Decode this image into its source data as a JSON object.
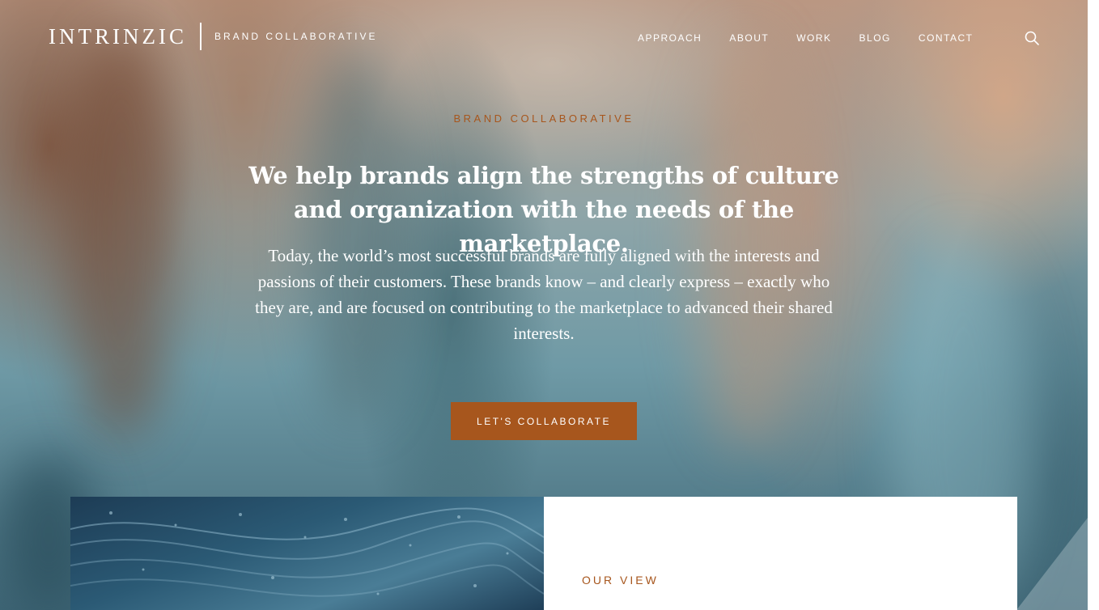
{
  "header": {
    "logo_text": "INTRINZIC",
    "logo_sub": "BRAND COLLABORATIVE",
    "nav": [
      {
        "label": "APPROACH"
      },
      {
        "label": "ABOUT"
      },
      {
        "label": "WORK"
      },
      {
        "label": "BLOG"
      },
      {
        "label": "CONTACT"
      }
    ],
    "search_icon": "search-icon"
  },
  "hero": {
    "eyebrow": "BRAND COLLABORATIVE",
    "headline": "We help brands align the strengths of culture and organization with the needs of the marketplace.",
    "body": "Today, the world’s most successful brands are fully aligned with the interests and passions of their customers. These brands know – and clearly express – exactly who they are, and are focused on contributing to the marketplace to advanced their shared interests.",
    "cta_label": "LET'S COLLABORATE"
  },
  "our_view": {
    "eyebrow": "OUR VIEW"
  },
  "colors": {
    "accent": "#a7561d",
    "text_light": "#ffffff"
  }
}
